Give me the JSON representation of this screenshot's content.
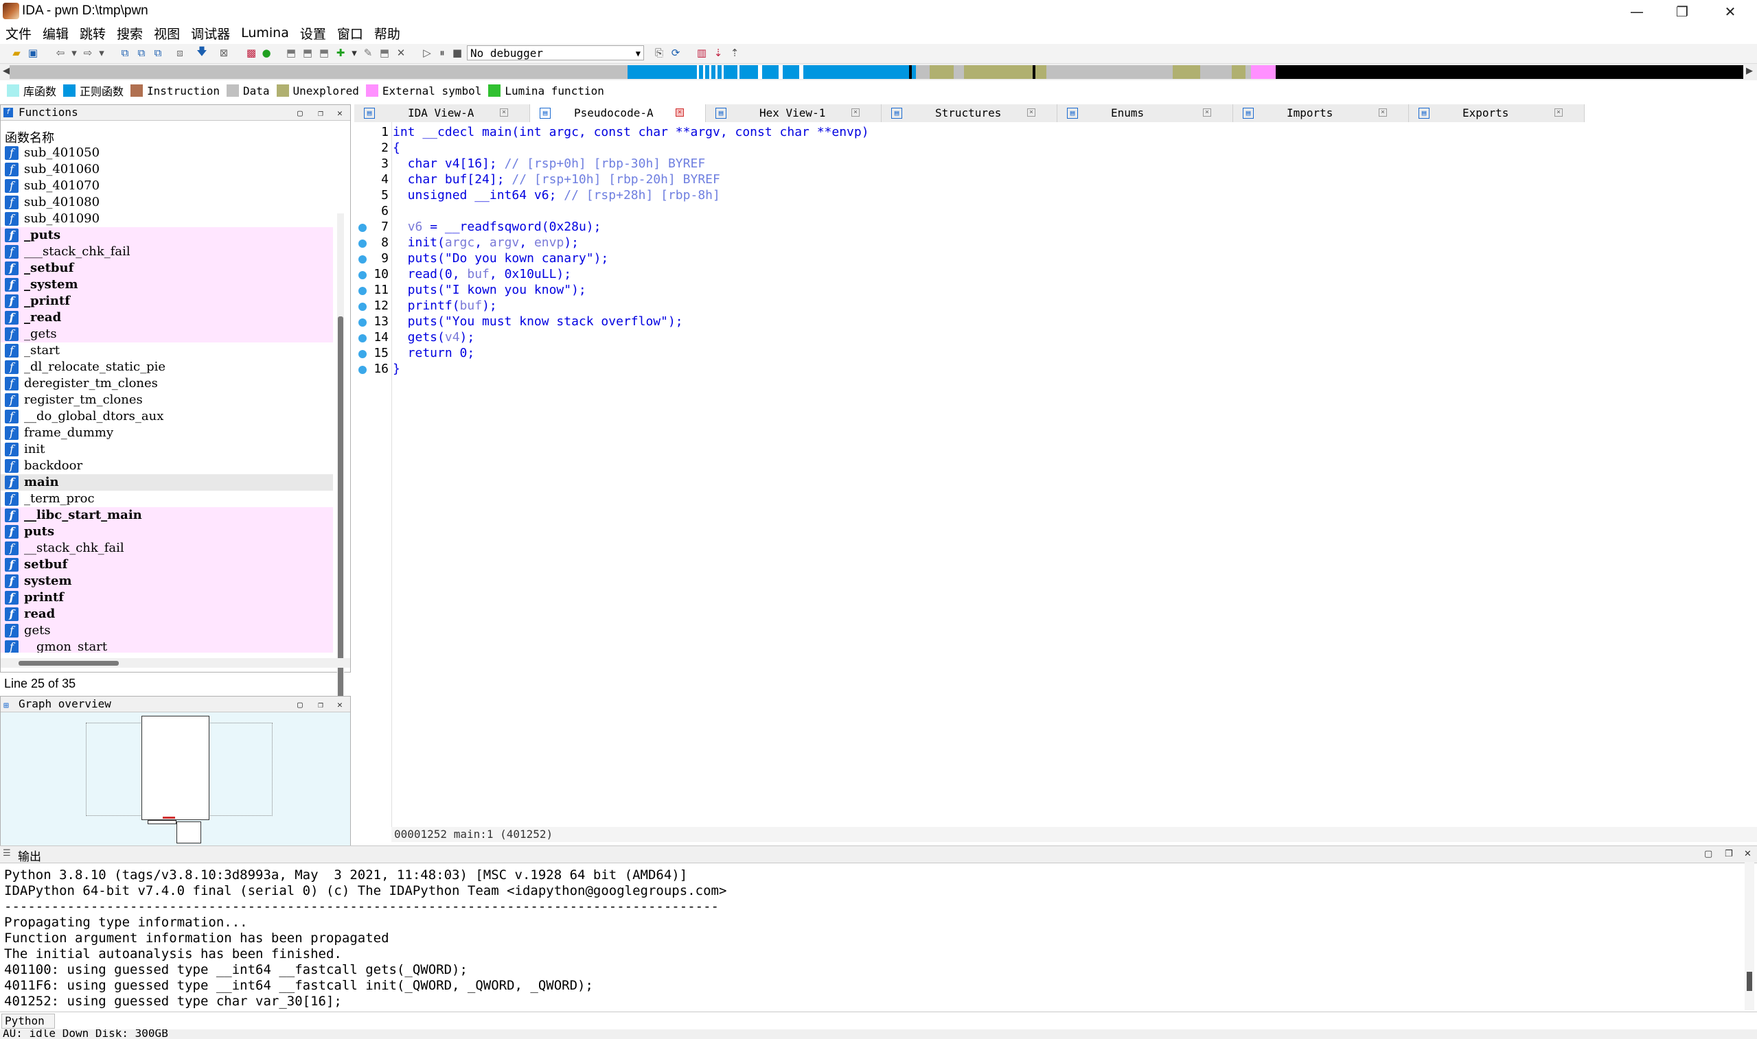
{
  "window": {
    "title": "IDA - pwn D:\\tmp\\pwn",
    "minimize": "—",
    "restore": "❐",
    "close": "✕"
  },
  "menu": [
    "文件",
    "编辑",
    "跳转",
    "搜索",
    "视图",
    "调试器",
    "Lumina",
    "设置",
    "窗口",
    "帮助"
  ],
  "toolbar": {
    "debugger": "No debugger"
  },
  "legend": [
    {
      "label": "库函数",
      "color": "#a8f0f0"
    },
    {
      "label": "正则函数",
      "color": "#0096e0"
    },
    {
      "label": "Instruction",
      "color": "#b07050"
    },
    {
      "label": "Data",
      "color": "#c0c0c0"
    },
    {
      "label": "Unexplored",
      "color": "#b0b070"
    },
    {
      "label": "External symbol",
      "color": "#ff90ff"
    },
    {
      "label": "Lumina function",
      "color": "#30c030"
    }
  ],
  "functions_panel": {
    "title": "Functions",
    "column_header": "函数名称",
    "status": "Line 25 of 35",
    "items": [
      {
        "name": "sub_401050",
        "lib": false,
        "bold": false
      },
      {
        "name": "sub_401060",
        "lib": false,
        "bold": false
      },
      {
        "name": "sub_401070",
        "lib": false,
        "bold": false
      },
      {
        "name": "sub_401080",
        "lib": false,
        "bold": false
      },
      {
        "name": "sub_401090",
        "lib": false,
        "bold": false
      },
      {
        "name": "_puts",
        "lib": true,
        "bold": true
      },
      {
        "name": "___stack_chk_fail",
        "lib": true,
        "bold": false
      },
      {
        "name": "_setbuf",
        "lib": true,
        "bold": true
      },
      {
        "name": "_system",
        "lib": true,
        "bold": true
      },
      {
        "name": "_printf",
        "lib": true,
        "bold": true
      },
      {
        "name": "_read",
        "lib": true,
        "bold": true
      },
      {
        "name": "_gets",
        "lib": true,
        "bold": false
      },
      {
        "name": "_start",
        "lib": false,
        "bold": false
      },
      {
        "name": "_dl_relocate_static_pie",
        "lib": false,
        "bold": false
      },
      {
        "name": "deregister_tm_clones",
        "lib": false,
        "bold": false
      },
      {
        "name": "register_tm_clones",
        "lib": false,
        "bold": false
      },
      {
        "name": "__do_global_dtors_aux",
        "lib": false,
        "bold": false
      },
      {
        "name": "frame_dummy",
        "lib": false,
        "bold": false
      },
      {
        "name": "init",
        "lib": false,
        "bold": false
      },
      {
        "name": "backdoor",
        "lib": false,
        "bold": false
      },
      {
        "name": "main",
        "lib": false,
        "bold": true,
        "selected": true
      },
      {
        "name": "_term_proc",
        "lib": false,
        "bold": false
      },
      {
        "name": "__libc_start_main",
        "lib": true,
        "bold": true
      },
      {
        "name": "puts",
        "lib": true,
        "bold": true
      },
      {
        "name": "__stack_chk_fail",
        "lib": true,
        "bold": false
      },
      {
        "name": "setbuf",
        "lib": true,
        "bold": true
      },
      {
        "name": "system",
        "lib": true,
        "bold": true
      },
      {
        "name": "printf",
        "lib": true,
        "bold": true
      },
      {
        "name": "read",
        "lib": true,
        "bold": true
      },
      {
        "name": "gets",
        "lib": true,
        "bold": false
      },
      {
        "name": "__gmon_start__",
        "lib": true,
        "bold": false
      }
    ]
  },
  "graph_overview": {
    "title": "Graph overview"
  },
  "tabs": [
    {
      "label": "IDA View-A",
      "icon": "ida-view-icon"
    },
    {
      "label": "Pseudocode-A",
      "icon": "pseudocode-icon",
      "active": true
    },
    {
      "label": "Hex View-1",
      "icon": "hex-view-icon"
    },
    {
      "label": "Structures",
      "icon": "structures-icon"
    },
    {
      "label": "Enums",
      "icon": "enums-icon"
    },
    {
      "label": "Imports",
      "icon": "imports-icon"
    },
    {
      "label": "Exports",
      "icon": "exports-icon"
    }
  ],
  "code": {
    "lines": [
      {
        "n": "1",
        "dot": false,
        "parts": [
          [
            "int __cdecl main(int argc, const char **argv, const char **envp)",
            ""
          ]
        ]
      },
      {
        "n": "2",
        "dot": false,
        "parts": [
          [
            "{",
            ""
          ]
        ]
      },
      {
        "n": "3",
        "dot": false,
        "parts": [
          [
            "  char v4[16]; ",
            ""
          ],
          [
            "// [rsp+0h] [rbp-30h] BYREF",
            "cmt"
          ]
        ]
      },
      {
        "n": "4",
        "dot": false,
        "parts": [
          [
            "  char buf[24]; ",
            ""
          ],
          [
            "// [rsp+10h] [rbp-20h] BYREF",
            "cmt"
          ]
        ]
      },
      {
        "n": "5",
        "dot": false,
        "parts": [
          [
            "  unsigned __int64 v6; ",
            ""
          ],
          [
            "// [rsp+28h] [rbp-8h]",
            "cmt"
          ]
        ]
      },
      {
        "n": "6",
        "dot": false,
        "parts": [
          [
            "",
            ""
          ]
        ]
      },
      {
        "n": "7",
        "dot": true,
        "parts": [
          [
            "  ",
            ""
          ],
          [
            "v6",
            "var"
          ],
          [
            " = __readfsqword(0x28u);",
            ""
          ]
        ]
      },
      {
        "n": "8",
        "dot": true,
        "parts": [
          [
            "  init(",
            ""
          ],
          [
            "argc",
            "var"
          ],
          [
            ", ",
            ""
          ],
          [
            "argv",
            "var"
          ],
          [
            ", ",
            ""
          ],
          [
            "envp",
            "var"
          ],
          [
            ");",
            ""
          ]
        ]
      },
      {
        "n": "9",
        "dot": true,
        "parts": [
          [
            "  puts(\"Do you kown canary\");",
            ""
          ]
        ]
      },
      {
        "n": "10",
        "dot": true,
        "parts": [
          [
            "  read(0, ",
            ""
          ],
          [
            "buf",
            "var"
          ],
          [
            ", 0x10uLL);",
            ""
          ]
        ]
      },
      {
        "n": "11",
        "dot": true,
        "parts": [
          [
            "  puts(\"I kown you know\");",
            ""
          ]
        ]
      },
      {
        "n": "12",
        "dot": true,
        "parts": [
          [
            "  printf(",
            ""
          ],
          [
            "buf",
            "var"
          ],
          [
            ");",
            ""
          ]
        ]
      },
      {
        "n": "13",
        "dot": true,
        "parts": [
          [
            "  puts(\"You must know stack overflow\");",
            ""
          ]
        ]
      },
      {
        "n": "14",
        "dot": true,
        "parts": [
          [
            "  gets(",
            ""
          ],
          [
            "v4",
            "var"
          ],
          [
            ");",
            ""
          ]
        ]
      },
      {
        "n": "15",
        "dot": true,
        "parts": [
          [
            "  return 0;",
            ""
          ]
        ]
      },
      {
        "n": "16",
        "dot": true,
        "parts": [
          [
            "}",
            ""
          ]
        ]
      }
    ],
    "status": "00001252 main:1 (401252)"
  },
  "output": {
    "title": "输出",
    "lines": [
      "Python 3.8.10 (tags/v3.8.10:3d8993a, May  3 2021, 11:48:03) [MSC v.1928 64 bit (AMD64)]",
      "IDAPython 64-bit v7.4.0 final (serial 0) (c) The IDAPython Team <idapython@googlegroups.com>",
      "-------------------------------------------------------------------------------------------",
      "Propagating type information...",
      "Function argument information has been propagated",
      "The initial autoanalysis has been finished.",
      "401100: using guessed type __int64 __fastcall gets(_QWORD);",
      "4011F6: using guessed type __int64 __fastcall init(_QWORD, _QWORD, _QWORD);",
      "401252: using guessed type char var_30[16];"
    ],
    "input_label": "Python"
  },
  "statusbar": {
    "text": "AU: idle   Down   Disk: 300GB"
  }
}
